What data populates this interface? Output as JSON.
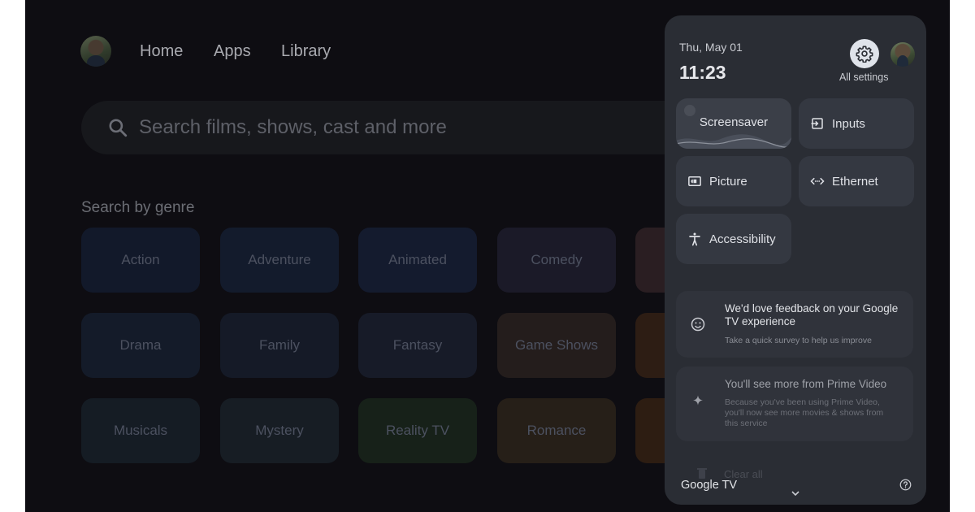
{
  "nav": {
    "links": [
      "Home",
      "Apps",
      "Library"
    ]
  },
  "search": {
    "placeholder": "Search films, shows, cast and more"
  },
  "genres": {
    "heading": "Search by genre",
    "items": [
      {
        "label": "Action",
        "color": "#12192a"
      },
      {
        "label": "Adventure",
        "color": "#131b2c"
      },
      {
        "label": "Animated",
        "color": "#141b2e"
      },
      {
        "label": "Comedy",
        "color": "#1b1a28"
      },
      {
        "label": "Drama",
        "color": "#141b29"
      },
      {
        "label": "Family",
        "color": "#151a27"
      },
      {
        "label": "Fantasy",
        "color": "#171b28"
      },
      {
        "label": "Game Shows",
        "color": "#241d1c"
      },
      {
        "label": "Musicals",
        "color": "#151c24"
      },
      {
        "label": "Mystery",
        "color": "#171d24"
      },
      {
        "label": "Reality TV",
        "color": "#172119"
      },
      {
        "label": "Romance",
        "color": "#261f18"
      }
    ],
    "partial_tile_colors": [
      "#2a1e22",
      "#2d1d14",
      "#2d1d12"
    ]
  },
  "quick_settings": {
    "date": "Thu, May 01",
    "time": "11:23",
    "settings_label": "All settings",
    "tiles": {
      "screensaver": "Screensaver",
      "inputs": "Inputs",
      "picture": "Picture",
      "ethernet": "Ethernet",
      "accessibility": "Accessibility"
    },
    "feedback": {
      "title": "We'd love feedback on your Google TV experience",
      "subtitle": "Take a quick survey to help us improve"
    },
    "prime": {
      "title": "You'll see more from Prime Video",
      "subtitle": "Because you've been using Prime Video, you'll now see more movies & shows from this service"
    },
    "clear_all": "Clear all",
    "brand": "Google TV"
  }
}
